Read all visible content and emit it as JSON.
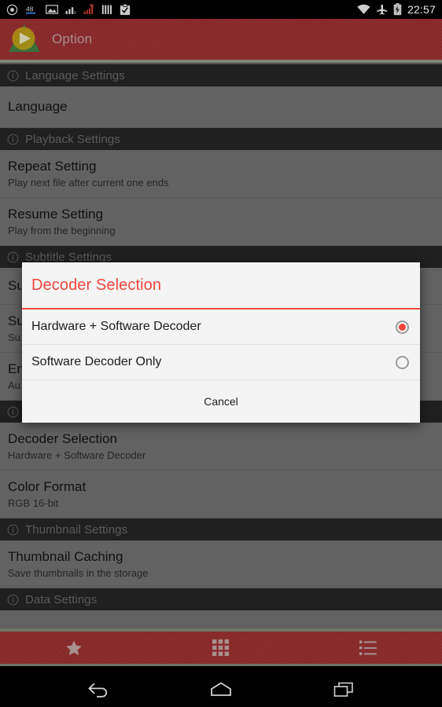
{
  "status_bar": {
    "time": "22:57",
    "left_icons": [
      {
        "name": "target-circle-icon"
      },
      {
        "name": "download-48-icon",
        "label": "48"
      },
      {
        "name": "screenshot-image-icon"
      },
      {
        "name": "signal-bars-icon"
      },
      {
        "name": "signal-error-icon"
      },
      {
        "name": "equalizer-bars-icon"
      },
      {
        "name": "clipboard-check-icon"
      }
    ],
    "right_icons": [
      {
        "name": "wifi-icon"
      },
      {
        "name": "airplane-mode-icon"
      },
      {
        "name": "battery-charging-icon"
      }
    ]
  },
  "action_bar": {
    "title": "Option",
    "logo_name": "app-logo-play-icon"
  },
  "colors": {
    "accent_red": "#f1473d",
    "bar_red": "#8b2a2c",
    "section_header_bg": "#333333",
    "dialog_bg": "#f4f4f4",
    "list_bg": "#9a9a9a"
  },
  "settings": {
    "sections": [
      {
        "header": "Language Settings",
        "items": [
          {
            "title": "Language",
            "summary": ""
          }
        ]
      },
      {
        "header": "Playback Settings",
        "items": [
          {
            "title": "Repeat Setting",
            "summary": "Play next file after current one ends"
          },
          {
            "title": "Resume Setting",
            "summary": "Play from the beginning"
          }
        ]
      },
      {
        "header": "Subtitle Settings",
        "items": [
          {
            "title": "Su",
            "summary": ""
          },
          {
            "title": "Su",
            "summary": "Su"
          },
          {
            "title": "En",
            "summary": "Au"
          }
        ]
      },
      {
        "header": "",
        "items": [
          {
            "title": "Decoder Selection",
            "summary": "Hardware + Software Decoder"
          },
          {
            "title": "Color Format",
            "summary": "RGB 16-bit"
          }
        ]
      },
      {
        "header": "Thumbnail Settings",
        "items": [
          {
            "title": "Thumbnail Caching",
            "summary": "Save thumbnails in the storage"
          }
        ]
      },
      {
        "header": "Data Settings",
        "items": []
      }
    ]
  },
  "dialog": {
    "title": "Decoder Selection",
    "options": [
      {
        "label": "Hardware + Software Decoder",
        "selected": true
      },
      {
        "label": "Software Decoder Only",
        "selected": false
      }
    ],
    "cancel_label": "Cancel"
  },
  "tab_bar": {
    "tabs": [
      {
        "name": "tab-favorites",
        "icon": "star-icon"
      },
      {
        "name": "tab-grid",
        "icon": "grid-icon"
      },
      {
        "name": "tab-list",
        "icon": "list-icon"
      }
    ]
  },
  "nav_bar": {
    "buttons": [
      {
        "name": "nav-back",
        "icon": "back-arrow-icon"
      },
      {
        "name": "nav-home",
        "icon": "home-icon"
      },
      {
        "name": "nav-recents",
        "icon": "recents-icon"
      }
    ]
  }
}
